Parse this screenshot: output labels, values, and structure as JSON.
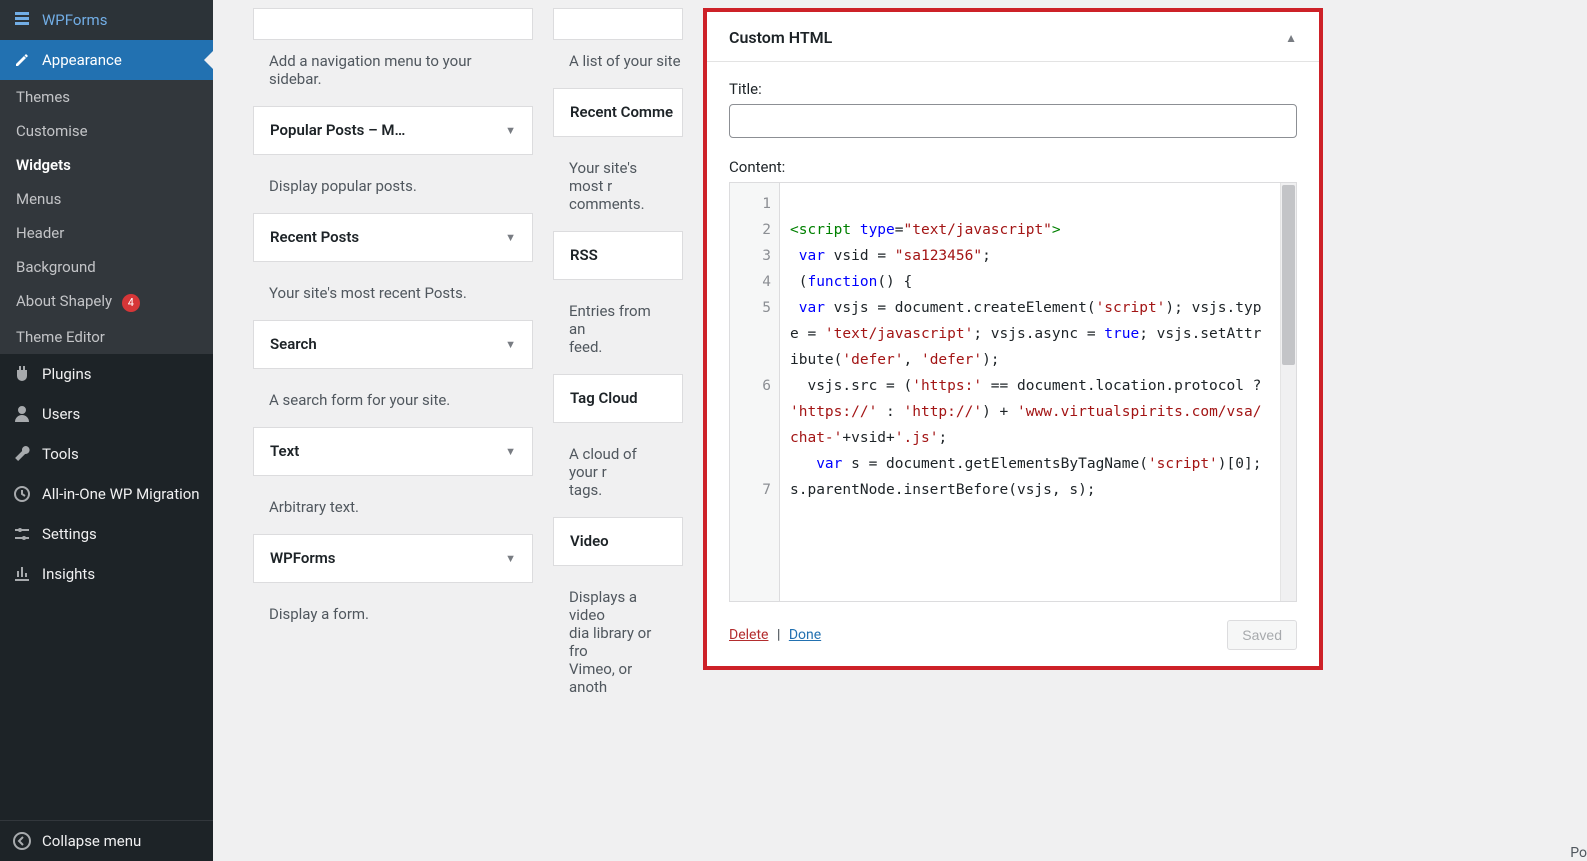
{
  "sidebar": {
    "top": {
      "label": "WPForms"
    },
    "appearance": {
      "label": "Appearance",
      "items": [
        "Themes",
        "Customise",
        "Widgets",
        "Menus",
        "Header",
        "Background",
        "About Shapely",
        "Theme Editor"
      ],
      "current": "Widgets",
      "badge": "4"
    },
    "rest": [
      {
        "label": "Plugins"
      },
      {
        "label": "Users"
      },
      {
        "label": "Tools"
      },
      {
        "label": "All-in-One WP Migration"
      },
      {
        "label": "Settings"
      },
      {
        "label": "Insights"
      }
    ],
    "collapse": "Collapse menu"
  },
  "pool": {
    "left": [
      {
        "title": "",
        "desc": "Add a navigation menu to your sidebar.",
        "headless": true
      },
      {
        "title": "Popular Posts – M…",
        "desc": "Display popular posts."
      },
      {
        "title": "Recent Posts",
        "desc": "Your site's most recent Posts."
      },
      {
        "title": "Search",
        "desc": "A search form for your site."
      },
      {
        "title": "Text",
        "desc": "Arbitrary text."
      },
      {
        "title": "WPForms",
        "desc": "Display a form."
      }
    ],
    "right": [
      {
        "title": "",
        "desc": "A list of your site",
        "headless": true
      },
      {
        "title": "Recent Comme",
        "desc": "Your site's most r\ncomments.",
        "short": true
      },
      {
        "title": "RSS",
        "desc": "Entries from an\nfeed.",
        "short": true
      },
      {
        "title": "Tag Cloud",
        "desc": "A cloud of your r\ntags.",
        "short": true
      },
      {
        "title": "Video",
        "desc": "Displays a video\ndia library or fro\nVimeo, or anoth",
        "short": true
      }
    ]
  },
  "panel": {
    "heading": "Custom HTML",
    "title_label": "Title:",
    "title_value": "",
    "content_label": "Content:",
    "gutter": [
      "1",
      "2",
      "3",
      "4",
      "5",
      "",
      "",
      "6",
      "",
      "",
      "",
      "7",
      "",
      "",
      ""
    ],
    "code_html": "<br><span class='kw'>&lt;script</span> <span class='attr'>type</span>=<span class='str'>\"text/javascript\"</span><span class='kw'>&gt;</span><br>&nbsp;<span class='var-kw'>var</span> vsid = <span class='str'>\"sa123456\"</span>;<br>&nbsp;(<span class='var-kw'>function</span>() {<br>&nbsp;<span class='var-kw'>var</span> vsjs = document.createElement(<span class='str'>'script'</span>); vsjs.type = <span class='str'>'text/javascript'</span>; vsjs.async = <span class='var-kw'>true</span>; vsjs.setAttribute(<span class='str'>'defer'</span>, <span class='str'>'defer'</span>);<br>&nbsp;&nbsp;vsjs.src = (<span class='str'>'https:'</span> == document.location.protocol ? <span class='str'>'https://'</span> : <span class='str'>'http://'</span>) + <span class='str'>'www.virtualspirits.com/vsa/chat-'</span>+vsid+<span class='str'>'.js'</span>;<br>&nbsp;&nbsp;&nbsp;<span class='var-kw'>var</span> s = document.getElementsByTagName(<span class='str'>'script'</span>)[0]; s.parentNode.insertBefore(vsjs, s);",
    "delete": "Delete",
    "done": "Done",
    "saved": "Saved"
  },
  "corner": "Po"
}
